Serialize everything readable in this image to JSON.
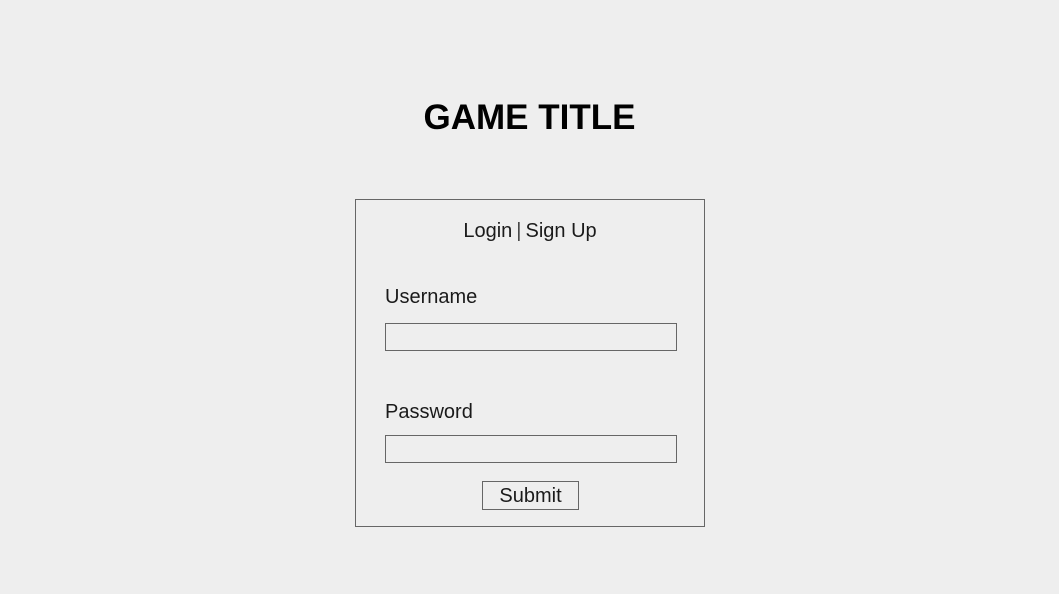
{
  "header": {
    "title": "GAME TITLE"
  },
  "auth_panel": {
    "tabs": {
      "login_label": "Login",
      "separator": "|",
      "signup_label": "Sign Up"
    },
    "username": {
      "label": "Username",
      "value": "",
      "placeholder": ""
    },
    "password": {
      "label": "Password",
      "value": "",
      "placeholder": ""
    },
    "submit_label": "Submit"
  },
  "colors": {
    "background": "#eeeeee",
    "border": "#666666",
    "text": "#1a1a1a",
    "title": "#000000"
  }
}
